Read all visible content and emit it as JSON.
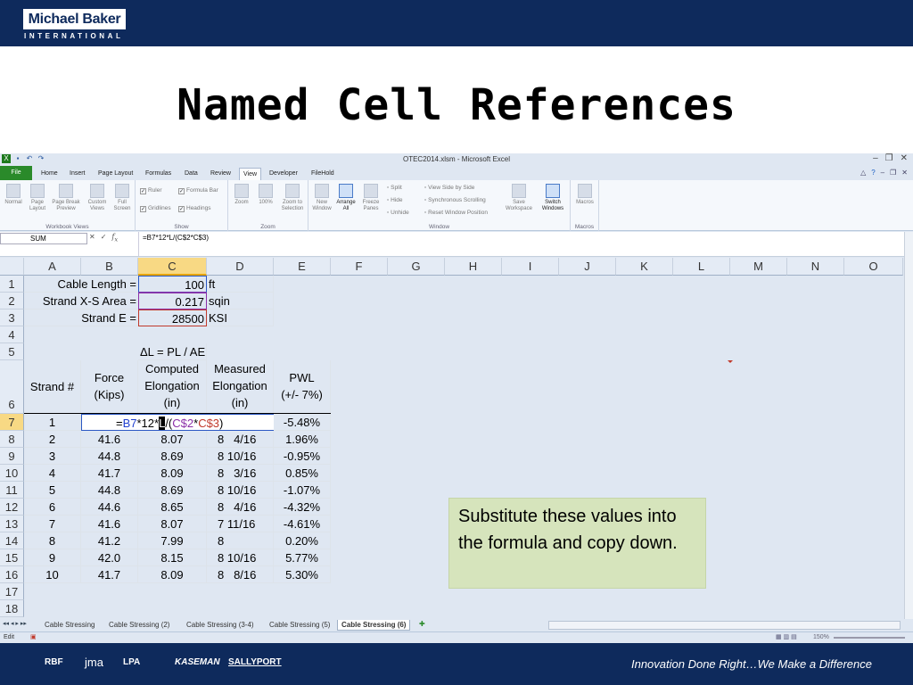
{
  "slide": {
    "logo": "Michael Baker",
    "logo_sub": "INTERNATIONAL",
    "title": "Named Cell References",
    "tagline": "Innovation Done Right…We Make a Difference",
    "partners": [
      "RBF",
      "jma",
      "LPA",
      "KASEMAN",
      "SALLYPORT"
    ]
  },
  "excel": {
    "window_title": "OTEC2014.xlsm - Microsoft Excel",
    "tabs": [
      "File",
      "Home",
      "Insert",
      "Page Layout",
      "Formulas",
      "Data",
      "Review",
      "View",
      "Developer",
      "FileHold"
    ],
    "active_tab": "View",
    "ribbon": {
      "workbook_views": {
        "label": "Workbook Views",
        "buttons": [
          "Normal",
          "Page Layout",
          "Page Break Preview",
          "Custom Views",
          "Full Screen"
        ]
      },
      "show": {
        "label": "Show",
        "items": [
          "Ruler",
          "Formula Bar",
          "Gridlines",
          "Headings"
        ]
      },
      "zoom": {
        "label": "Zoom",
        "buttons": [
          "Zoom",
          "100%",
          "Zoom to Selection"
        ]
      },
      "window": {
        "label": "Window",
        "buttons": [
          "New Window",
          "Arrange All",
          "Freeze Panes"
        ],
        "small": [
          "Split",
          "Hide",
          "Unhide",
          "View Side by Side",
          "Synchronous Scrolling",
          "Reset Window Position"
        ],
        "big": [
          "Save Workspace",
          "Switch Windows"
        ]
      },
      "macros": {
        "label": "Macros",
        "button": "Macros"
      }
    },
    "name_box": "SUM",
    "formula": "=B7*12*L/(C$2*C$3)",
    "columns": [
      "A",
      "B",
      "C",
      "D",
      "E",
      "F",
      "G",
      "H",
      "I",
      "J",
      "K",
      "L",
      "M",
      "N",
      "O"
    ],
    "selected_column": "C",
    "rows": [
      "1",
      "2",
      "3",
      "4",
      "5",
      "6",
      "7",
      "8",
      "9",
      "10",
      "11",
      "12",
      "13",
      "14",
      "15",
      "16",
      "17",
      "18"
    ],
    "selected_row": "7",
    "cells": {
      "A1": "Cable Length =",
      "C1": "100",
      "D1": "ft",
      "A2": "Strand X-S Area =",
      "C2": "0.217",
      "D2": "sqin",
      "A3": "Strand E =",
      "C3": "28500",
      "D3": "KSI",
      "C5": "ΔL = PL / AE",
      "A6": "Strand #",
      "B6a": "Force",
      "B6b": "(Kips)",
      "C6a": "Computed",
      "C6b": "Elongation",
      "C6c": "(in)",
      "D6a": "Measured",
      "D6b": "Elongation",
      "D6c": "(in)",
      "E6a": "PWL",
      "E6b": "(+/- 7%)",
      "A7": "1",
      "B7_edit": {
        "p1": "=",
        "p2": "B7",
        "p3": "*12*",
        "p4": "L",
        "p5": "/(",
        "p6": "C$2",
        "p7": "*",
        "p8": "C$3",
        "p9": ")"
      },
      "E7": "-5.48%"
    },
    "table": [
      {
        "a": "2",
        "b": "41.6",
        "c": "8.07",
        "d": "8   4/16",
        "e": "1.96%"
      },
      {
        "a": "3",
        "b": "44.8",
        "c": "8.69",
        "d": "8 10/16",
        "e": "-0.95%"
      },
      {
        "a": "4",
        "b": "41.7",
        "c": "8.09",
        "d": "8   3/16",
        "e": "0.85%"
      },
      {
        "a": "5",
        "b": "44.8",
        "c": "8.69",
        "d": "8 10/16",
        "e": "-1.07%"
      },
      {
        "a": "6",
        "b": "44.6",
        "c": "8.65",
        "d": "8   4/16",
        "e": "-4.32%"
      },
      {
        "a": "7",
        "b": "41.6",
        "c": "8.07",
        "d": "7 11/16",
        "e": "-4.61%"
      },
      {
        "a": "8",
        "b": "41.2",
        "c": "7.99",
        "d": "8",
        "e": "0.20%"
      },
      {
        "a": "9",
        "b": "42.0",
        "c": "8.15",
        "d": "8 10/16",
        "e": "5.77%"
      },
      {
        "a": "10",
        "b": "41.7",
        "c": "8.09",
        "d": "8   8/16",
        "e": "5.30%"
      }
    ],
    "callout": "Substitute these values into the formula and copy down.",
    "sheet_tabs": [
      "Cable Stressing",
      "Cable Stressing (2)",
      "Cable Stressing (3-4)",
      "Cable Stressing (5)",
      "Cable Stressing (6)"
    ],
    "active_sheet": "Cable Stressing (6)",
    "status_mode": "Edit",
    "zoom_level": "150%",
    "colors": {
      "ref_blue": "#1f3fd0",
      "ref_purple": "#8b2fa8",
      "ref_red": "#c0392b",
      "header_navy": "#0e2a5c"
    }
  }
}
